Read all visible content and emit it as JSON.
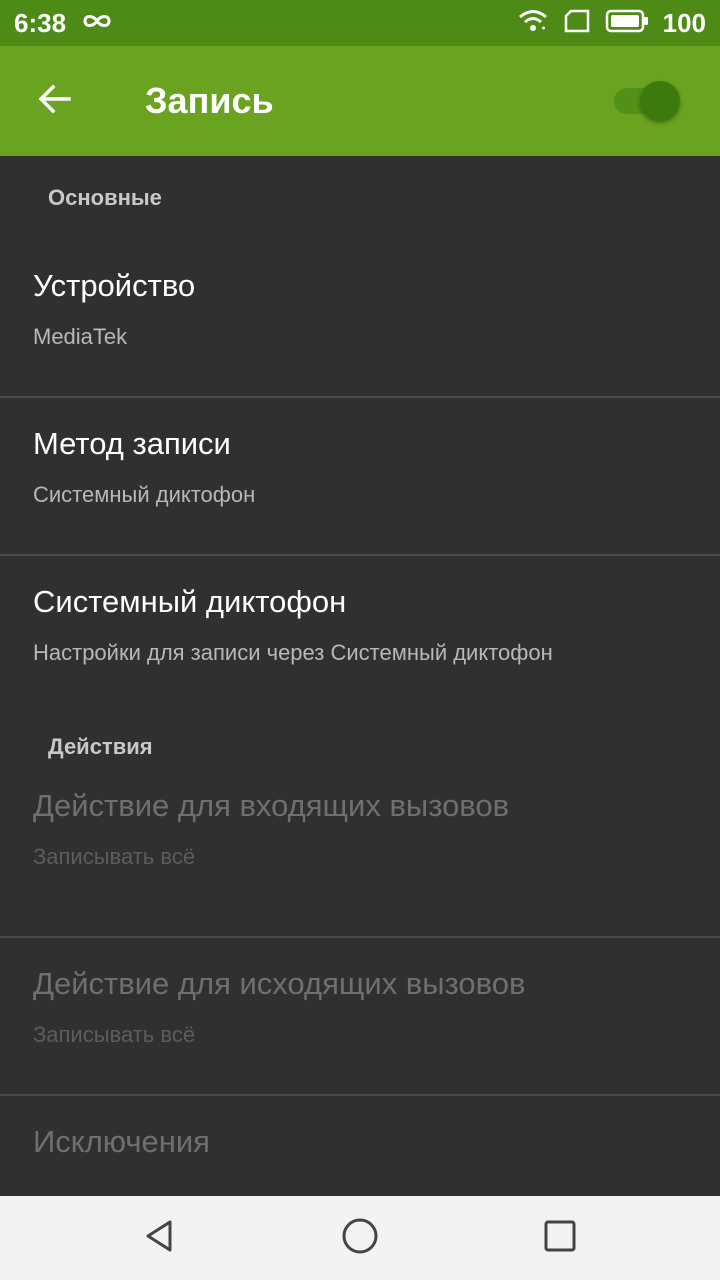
{
  "status_bar": {
    "time": "6:38",
    "battery": "100",
    "icons": [
      "infinity-icon",
      "wifi-icon",
      "sd-card-icon",
      "battery-icon"
    ]
  },
  "app_bar": {
    "title": "Запись",
    "back_icon": "arrow-back-icon",
    "switch_on": true,
    "color": "#6aa31f"
  },
  "sections": [
    {
      "header": "Основные",
      "items": [
        {
          "title": "Устройство",
          "summary": "MediaTek",
          "enabled": true
        },
        {
          "title": "Метод записи",
          "summary": "Системный диктофон",
          "enabled": true
        },
        {
          "title": "Системный диктофон",
          "summary": "Настройки для записи через Системный диктофон",
          "enabled": true
        }
      ]
    },
    {
      "header": "Действия",
      "items": [
        {
          "title": "Действие для входящих вызовов",
          "summary": "Записывать всё",
          "enabled": false
        },
        {
          "title": "Действие для исходящих вызовов",
          "summary": "Записывать всё",
          "enabled": false
        },
        {
          "title": "Исключения",
          "summary": "",
          "enabled": false
        }
      ]
    }
  ],
  "nav_bar": {
    "icons": [
      "back-triangle-icon",
      "home-circle-icon",
      "recents-square-icon"
    ]
  }
}
